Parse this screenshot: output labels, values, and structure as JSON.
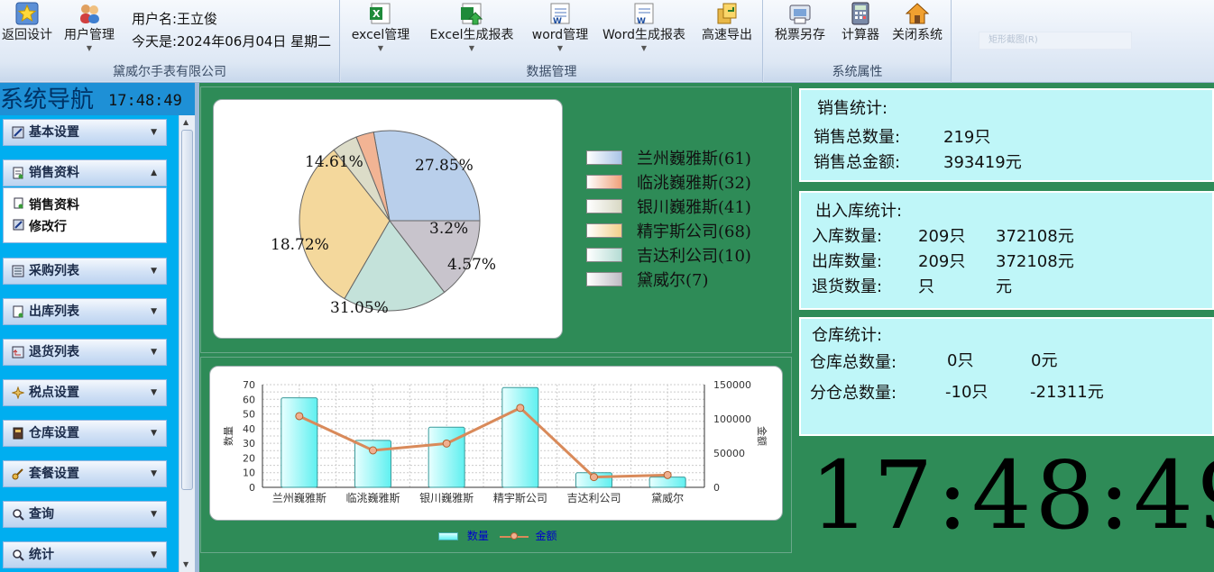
{
  "ribbon": {
    "left_buttons": {
      "return_design": "返回设计",
      "user_manage": "用户管理"
    },
    "user_label": "用户名:王立俊",
    "today_label": "今天是:2024年06月04日  星期二",
    "company_group": "黛威尔手表有限公司",
    "data_buttons": [
      "excel管理",
      "Excel生成报表",
      "word管理",
      "Word生成报表",
      "高速导出"
    ],
    "data_group": "数据管理",
    "sys_buttons": [
      "税票另存",
      "计算器",
      "关闭系统"
    ],
    "sys_group": "系统属性",
    "faded_input": "矩形截图(R)"
  },
  "nav": {
    "title": "系统导航",
    "time": "17:48:49",
    "items": [
      "基本设置",
      "销售资料",
      "采购列表",
      "出库列表",
      "退货列表",
      "税点设置",
      "仓库设置",
      "套餐设置",
      "查询",
      "统计"
    ],
    "sub_items": [
      "销售资料",
      "修改行"
    ]
  },
  "pie": {
    "labels": [
      "27.85%",
      "3.2%",
      "4.57%",
      "31.05%",
      "18.72%",
      "14.61%"
    ],
    "legend": [
      "兰州巍雅斯(61)",
      "临洮巍雅斯(32)",
      "银川巍雅斯(41)",
      "精宇斯公司(68)",
      "吉达利公司(10)",
      "黛威尔(7)"
    ]
  },
  "chart_data": {
    "type": "bar",
    "categories": [
      "兰州巍雅斯",
      "临洮巍雅斯",
      "银川巍雅斯",
      "精宇斯公司",
      "吉达利公司",
      "黛威尔"
    ],
    "series": [
      {
        "name": "数量",
        "type": "bar",
        "axis": "left",
        "values": [
          61,
          32,
          41,
          68,
          10,
          7
        ]
      },
      {
        "name": "金额",
        "type": "line",
        "axis": "right",
        "values": [
          104000,
          54000,
          64000,
          116000,
          15000,
          18000
        ]
      }
    ],
    "ylabel": "数量",
    "y2label": "金额",
    "ylim": [
      0,
      70
    ],
    "y2lim": [
      0,
      150000
    ],
    "yticks": [
      "70",
      "60",
      "50",
      "40",
      "30",
      "20",
      "10",
      "0"
    ],
    "y2ticks": [
      "150000",
      "100000",
      "50000",
      "0"
    ],
    "grid": true,
    "legend": "bottom",
    "colors": {
      "bar": "#5ff0f0",
      "line": "#d98a5a"
    }
  },
  "sales": {
    "title": "销售统计:",
    "qty_label": "销售总数量:",
    "qty": "219只",
    "amt_label": "销售总金额:",
    "amt": "393419元"
  },
  "inout": {
    "title": "出入库统计:",
    "in_label": "入库数量:",
    "in_qty": "209只",
    "in_amt": "372108元",
    "out_label": "出库数量:",
    "out_qty": "209只",
    "out_amt": "372108元",
    "ret_label": "退货数量:",
    "ret_qty": "只",
    "ret_amt": "元"
  },
  "stock": {
    "title": "仓库统计:",
    "total_label": "仓库总数量:",
    "total_qty": "0只",
    "total_amt": "0元",
    "branch_label": "分仓总数量:",
    "branch_qty": "-10只",
    "branch_amt": "-21311元"
  },
  "clock": "17:48:49"
}
